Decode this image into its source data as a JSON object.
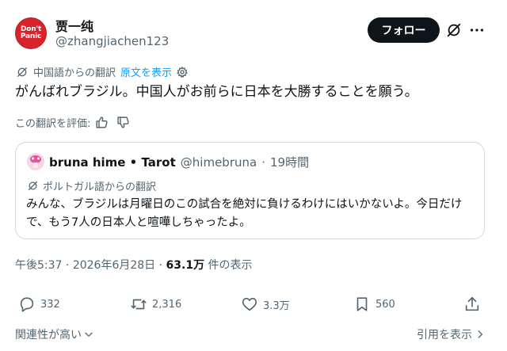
{
  "author": {
    "avatar_line1": "Don't",
    "avatar_line2": "Panic",
    "display_name": "贾一纯",
    "handle": "@zhangjiachen123",
    "follow_label": "フォロー"
  },
  "translation": {
    "source_label": "中国語からの翻訳",
    "show_original": "原文を表示"
  },
  "tweet": {
    "text": "がんばれブラジル。中国人がお前らに日本を大勝することを願う。"
  },
  "rating": {
    "label": "この翻訳を評価:"
  },
  "quote": {
    "name": "bruna hime • Tarot",
    "handle": "@himebruna",
    "separator": "·",
    "time": "19時間",
    "translation_label": "ポルトガル語からの翻訳",
    "text": "みんな、ブラジルは月曜日のこの試合を絶対に負けるわけにはいかないよ。今日だけで、もう7人の日本人と喧嘩しちゃったよ。"
  },
  "meta": {
    "time": "午後5:37",
    "date": "2026年6月28日",
    "separator": "·",
    "views": "63.1万",
    "views_label": "件の表示"
  },
  "actions": {
    "replies": "332",
    "reposts": "2,316",
    "likes": "3.3万",
    "bookmarks": "560"
  },
  "footer": {
    "sort_label": "関連性が高い",
    "quotes_label": "引用を表示"
  },
  "colors": {
    "accent": "#1d9bf0",
    "text": "#0f1419",
    "muted": "#536471",
    "border": "#cfd9de"
  }
}
